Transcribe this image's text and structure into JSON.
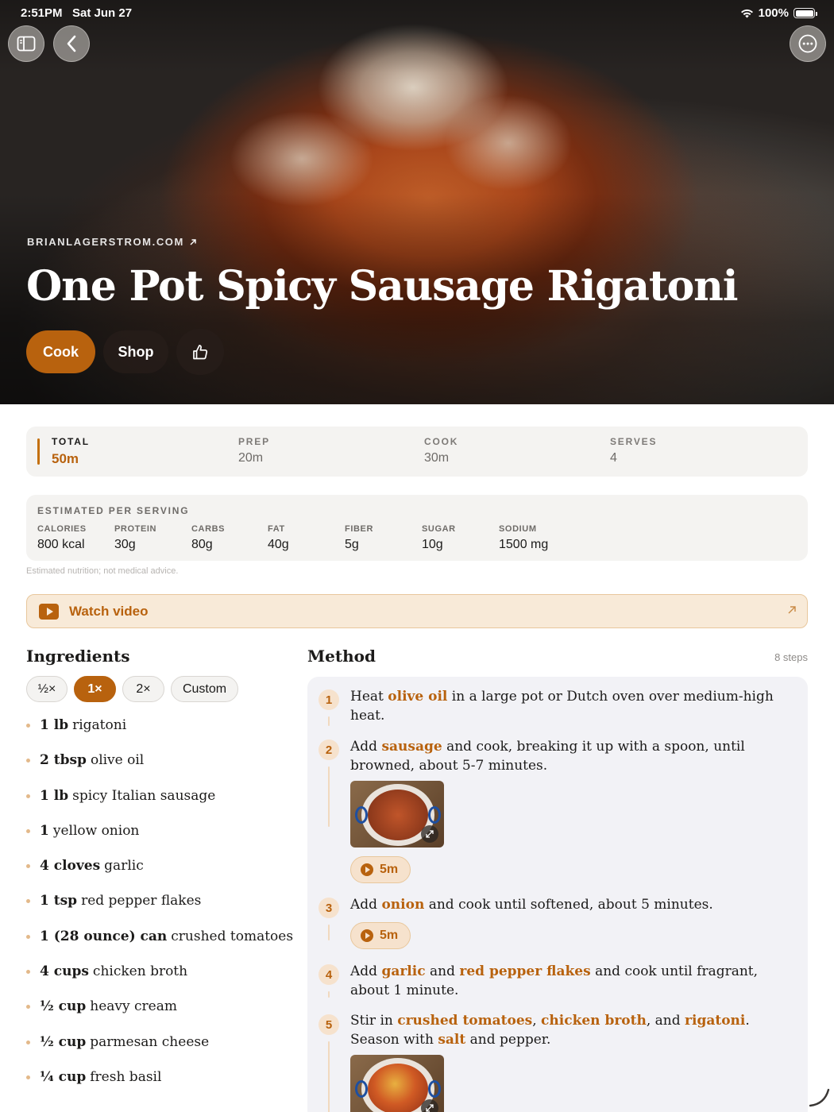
{
  "status_bar": {
    "time": "2:51PM",
    "date": "Sat Jun 27",
    "battery": "100%"
  },
  "hero": {
    "source": "BRIANLAGERSTROM.COM",
    "title": "One Pot Spicy Sausage Rigatoni",
    "actions": {
      "cook": "Cook",
      "shop": "Shop"
    }
  },
  "times": [
    {
      "label": "TOTAL",
      "value": "50m",
      "active": true
    },
    {
      "label": "PREP",
      "value": "20m",
      "active": false
    },
    {
      "label": "COOK",
      "value": "30m",
      "active": false
    },
    {
      "label": "SERVES",
      "value": "4",
      "active": false
    }
  ],
  "nutrition": {
    "heading": "ESTIMATED PER SERVING",
    "items": [
      {
        "label": "CALORIES",
        "value": "800 kcal"
      },
      {
        "label": "PROTEIN",
        "value": "30g"
      },
      {
        "label": "CARBS",
        "value": "80g"
      },
      {
        "label": "FAT",
        "value": "40g"
      },
      {
        "label": "FIBER",
        "value": "5g"
      },
      {
        "label": "SUGAR",
        "value": "10g"
      },
      {
        "label": "SODIUM",
        "value": "1500 mg"
      }
    ],
    "note": "Estimated nutrition; not medical advice."
  },
  "video": {
    "label": "Watch video"
  },
  "ingredients": {
    "title": "Ingredients",
    "scales": [
      {
        "label": "½×",
        "active": false
      },
      {
        "label": "1×",
        "active": true
      },
      {
        "label": "2×",
        "active": false
      },
      {
        "label": "Custom",
        "active": false
      }
    ],
    "items": [
      {
        "qty": "1 lb",
        "name": "rigatoni"
      },
      {
        "qty": "2 tbsp",
        "name": "olive oil"
      },
      {
        "qty": "1 lb",
        "name": "spicy Italian sausage"
      },
      {
        "qty": "1",
        "name": "yellow onion"
      },
      {
        "qty": "4 cloves",
        "name": "garlic"
      },
      {
        "qty": "1 tsp",
        "name": "red pepper flakes"
      },
      {
        "qty": "1 (28 ounce) can",
        "name": "crushed tomatoes"
      },
      {
        "qty": "4 cups",
        "name": "chicken broth"
      },
      {
        "qty": "½ cup",
        "name": "heavy cream"
      },
      {
        "qty": "½ cup",
        "name": "parmesan cheese"
      },
      {
        "qty": "¼ cup",
        "name": "fresh basil"
      }
    ]
  },
  "method": {
    "title": "Method",
    "step_count": "8 steps",
    "steps": [
      {
        "number": "1",
        "segments": [
          {
            "text": "Heat "
          },
          {
            "text": "olive oil",
            "hl": true
          },
          {
            "text": " in a large pot or Dutch oven over medium-high heat."
          }
        ]
      },
      {
        "number": "2",
        "segments": [
          {
            "text": "Add "
          },
          {
            "text": "sausage",
            "hl": true
          },
          {
            "text": " and cook, breaking it up with a spoon, until browned, about 5-7 minutes."
          }
        ],
        "timer": "5m"
      },
      {
        "number": "3",
        "segments": [
          {
            "text": "Add "
          },
          {
            "text": "onion",
            "hl": true
          },
          {
            "text": " and cook until softened, about 5 minutes."
          }
        ],
        "timer": "5m"
      },
      {
        "number": "4",
        "segments": [
          {
            "text": "Add "
          },
          {
            "text": "garlic",
            "hl": true
          },
          {
            "text": " and "
          },
          {
            "text": "red pepper flakes",
            "hl": true
          },
          {
            "text": " and cook until fragrant, about 1 minute."
          }
        ]
      },
      {
        "number": "5",
        "segments": [
          {
            "text": "Stir in "
          },
          {
            "text": "crushed tomatoes",
            "hl": true
          },
          {
            "text": ", "
          },
          {
            "text": "chicken broth",
            "hl": true
          },
          {
            "text": ", and "
          },
          {
            "text": "rigatoni",
            "hl": true
          },
          {
            "text": ". Season with "
          },
          {
            "text": "salt",
            "hl": true
          },
          {
            "text": " and pepper."
          }
        ]
      }
    ]
  },
  "colors": {
    "accent": "#b8620e",
    "accent_soft": "#f6e2cd",
    "card_bg": "#f4f3f1"
  }
}
